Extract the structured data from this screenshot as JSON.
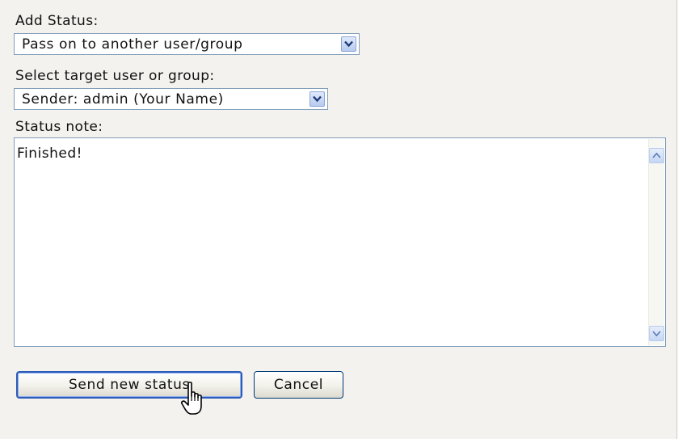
{
  "form": {
    "add_status_label": "Add Status:",
    "status_select": {
      "selected": "Pass on to another user/group"
    },
    "target_label": "Select target user or group:",
    "target_select": {
      "selected": "Sender: admin (Your Name)"
    },
    "note_label": "Status note:",
    "note_value": "Finished!"
  },
  "actions": {
    "send_label": "Send new status",
    "cancel_label": "Cancel"
  },
  "icons": {
    "dropdown": "chevron-down-icon",
    "scroll_up": "scroll-up-arrow-icon",
    "scroll_down": "scroll-down-arrow-icon",
    "cursor": "hand-pointer-cursor-icon"
  },
  "colors": {
    "page_background": "#f4f2ee",
    "field_border": "#7f9db9",
    "button_border": "#003c74",
    "default_button_ring": "#2e5bb8",
    "scroll_button": "#c5d6f3"
  }
}
